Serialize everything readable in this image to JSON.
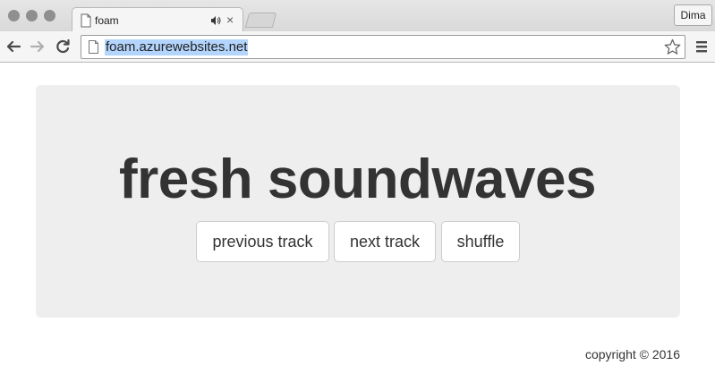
{
  "browser": {
    "tab": {
      "title": "foam",
      "icon": "document-icon",
      "audio_icon": "speaker-icon",
      "close_label": "×"
    },
    "profile_label": "Dima",
    "address_bar": {
      "url": "foam.azurewebsites.net",
      "icon": "document-icon"
    },
    "nav": {
      "back_icon": "arrow-left-icon",
      "forward_icon": "arrow-right-icon",
      "reload_icon": "reload-icon"
    },
    "menu_icon": "hamburger-icon",
    "bookmark_icon": "star-icon"
  },
  "page": {
    "headline": "fresh soundwaves",
    "buttons": {
      "previous": "previous track",
      "next": "next track",
      "shuffle": "shuffle"
    },
    "footer": "copyright © 2016"
  },
  "colors": {
    "jumbotron_bg": "#eeeeee",
    "text": "#333333",
    "url_highlight": "#b3d4fc"
  }
}
